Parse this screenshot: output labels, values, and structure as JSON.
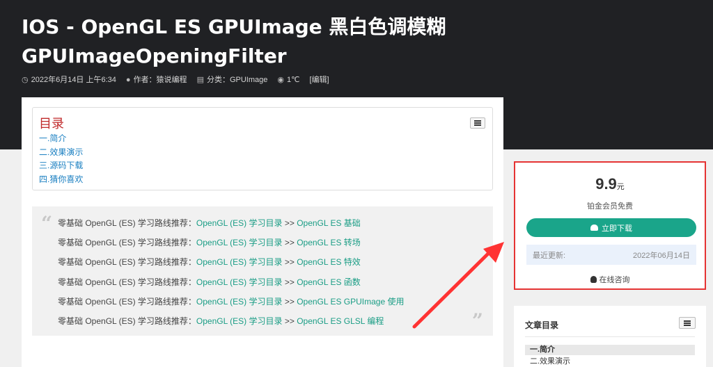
{
  "header": {
    "title": "IOS  -  OpenGL ES GPUImage 黑白色调模糊 GPUImageOpeningFilter",
    "date": "2022年6月14日 上午6:34",
    "author": "作者：猿说编程",
    "category": "分类：GPUImage",
    "views": "1℃",
    "edit": "[编辑]"
  },
  "toc": {
    "title": "目录",
    "items": [
      "一.简介",
      "二.效果演示",
      "三.源码下载",
      "四.猜你喜欢"
    ]
  },
  "quote": {
    "prefix": "零基础 OpenGL (ES) 学习路线推荐：",
    "link1": "OpenGL (ES) 学习目录",
    "separator": " >> ",
    "items": [
      "OpenGL ES 基础",
      "OpenGL ES 转场",
      "OpenGL ES 特效",
      "OpenGL ES 函数",
      "OpenGL ES GPUImage 使用",
      "OpenGL ES GLSL 编程"
    ]
  },
  "sidebar": {
    "price": "9.9",
    "price_unit": "元",
    "price_note": "铂金会员免费",
    "download_label": "立即下载",
    "update_label": "最近更新:",
    "update_date": "2022年06月14日",
    "consult_label": "在线咨询"
  },
  "sidebar_toc": {
    "title": "文章目录",
    "items": [
      "一.简介",
      "二.效果演示"
    ]
  },
  "colors": {
    "accent": "#1aa58a",
    "annotation": "#e53333"
  }
}
